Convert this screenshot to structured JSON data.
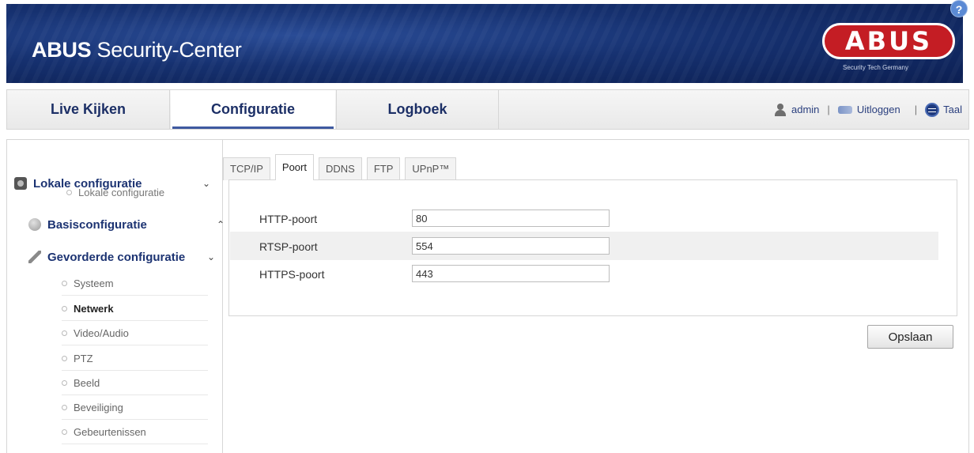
{
  "header": {
    "title_bold": "ABUS",
    "title_rest": " Security-Center",
    "logo_text": "ABUS",
    "logo_subtext": "Security Tech Germany",
    "help_label": "?"
  },
  "nav": {
    "tabs": [
      {
        "label": "Live Kijken"
      },
      {
        "label": "Configuratie"
      },
      {
        "label": "Logboek"
      }
    ],
    "user": "admin",
    "separator": "|",
    "logout": "Uitloggen",
    "language": "Taal"
  },
  "sidebar": {
    "sections": [
      {
        "label": "Lokale configuratie",
        "chevron": "⌄",
        "icon": "camera-icon"
      },
      {
        "label": "Basisconfiguratie",
        "chevron": "⌃",
        "icon": "disk-icon"
      },
      {
        "label": "Gevorderde configuratie",
        "chevron": "⌄",
        "icon": "wrench-icon"
      }
    ],
    "local_items": [
      "Lokale configuratie"
    ],
    "advanced_items": [
      "Systeem",
      "Netwerk",
      "Video/Audio",
      "PTZ",
      "Beeld",
      "Beveiliging",
      "Gebeurtenissen"
    ],
    "active_item": "Netwerk"
  },
  "tabs": [
    "TCP/IP",
    "Poort",
    "DDNS",
    "FTP",
    "UPnP™"
  ],
  "active_tab": "Poort",
  "form": {
    "rows": [
      {
        "label": "HTTP-poort",
        "value": "80"
      },
      {
        "label": "RTSP-poort",
        "value": "554"
      },
      {
        "label": "HTTPS-poort",
        "value": "443"
      }
    ]
  },
  "save_label": "Opslaan",
  "colors": {
    "banner": "#163170",
    "nav_text": "#1c2f66",
    "logo_red": "#c41d24"
  }
}
